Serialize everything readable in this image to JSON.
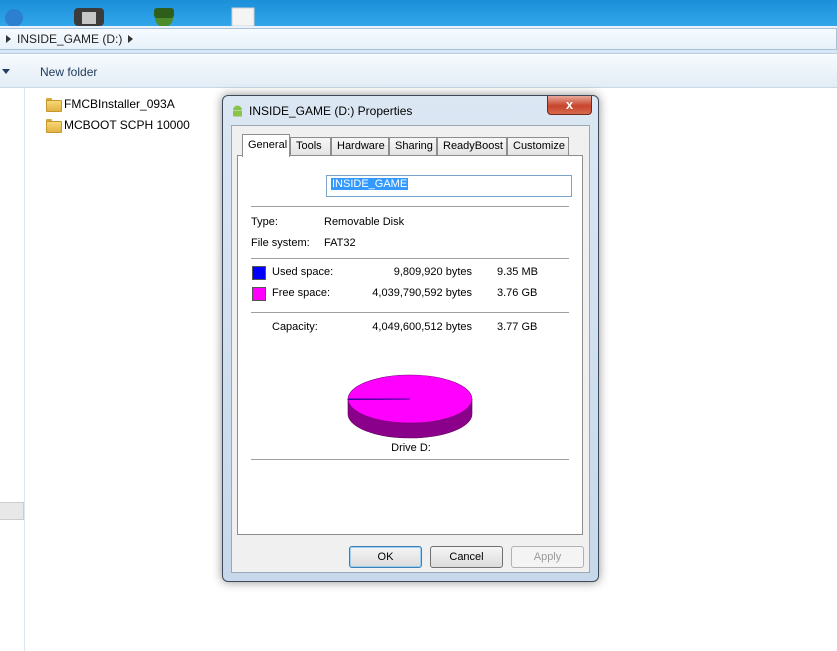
{
  "explorer": {
    "breadcrumb": "INSIDE_GAME (D:)",
    "toolbar": {
      "new_folder": "New folder"
    },
    "files": [
      {
        "name": "FMCBInstaller_093A"
      },
      {
        "name": "MCBOOT SCPH 10000"
      }
    ]
  },
  "dialog": {
    "title": "INSIDE_GAME (D:) Properties",
    "close_label": "x",
    "tabs": [
      "General",
      "Tools",
      "Hardware",
      "Sharing",
      "ReadyBoost",
      "Customize"
    ],
    "active_tab": "General",
    "volume_name": "INSIDE_GAME",
    "type_label": "Type:",
    "type_value": "Removable Disk",
    "fs_label": "File system:",
    "fs_value": "FAT32",
    "used_label": "Used space:",
    "used_bytes": "9,809,920 bytes",
    "used_human": "9.35 MB",
    "free_label": "Free space:",
    "free_bytes": "4,039,790,592 bytes",
    "free_human": "3.76 GB",
    "capacity_label": "Capacity:",
    "capacity_bytes": "4,049,600,512 bytes",
    "capacity_human": "3.77 GB",
    "drive_label": "Drive D:",
    "used_fraction": 0.0024,
    "used_color": "#0000ff",
    "free_color": "#ff00ff",
    "free_shadow": "#8b008b",
    "buttons": {
      "ok": "OK",
      "cancel": "Cancel",
      "apply": "Apply"
    }
  }
}
